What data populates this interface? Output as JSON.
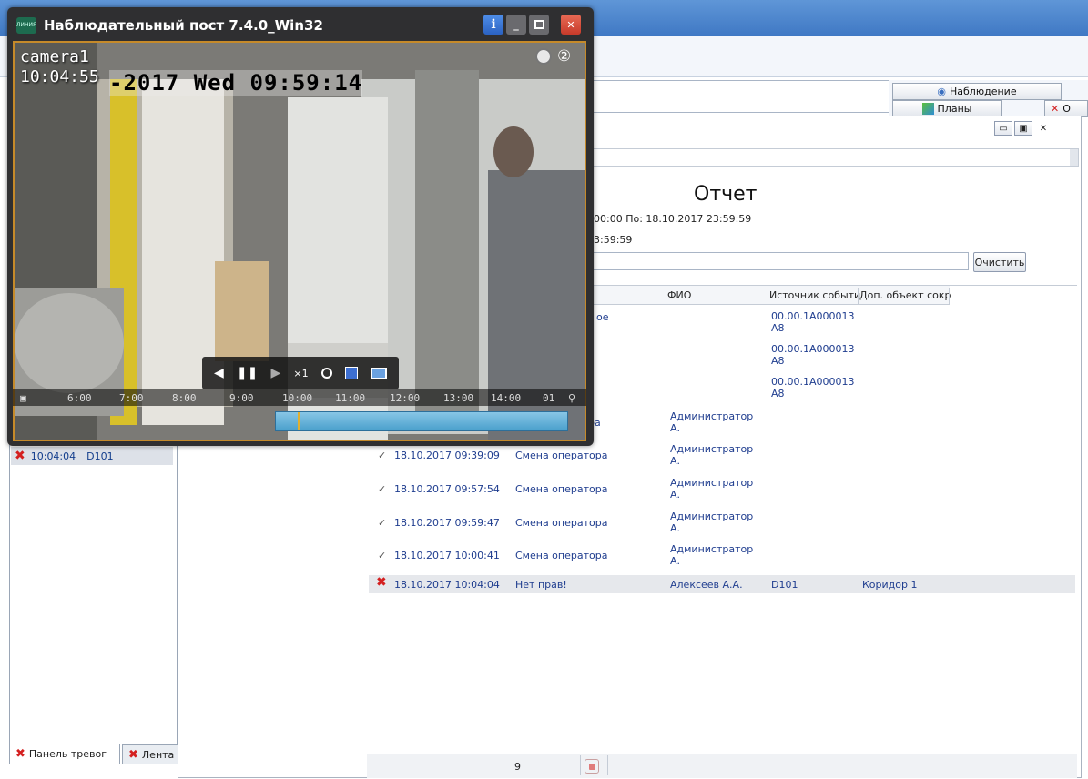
{
  "app": {
    "title": "Наблюдательный пост 7.4.0_Win32",
    "logo_text": "ЛИНИЯ"
  },
  "video": {
    "camera_name": "camera1",
    "time": "10:04:55",
    "osd_text": "-2017 Wed 09:59:14",
    "speed": "×1",
    "badge": "②",
    "timeline_ticks": [
      "6:00",
      "7:00",
      "8:00",
      "9:00",
      "10:00",
      "11:00",
      "12:00",
      "13:00",
      "14:00"
    ],
    "end_label": "01"
  },
  "bg": {
    "tab_observation": "Наблюдение",
    "tab_plans": "Планы",
    "tab_partial": "О",
    "left_alarm_time": "10:04:04",
    "left_alarm_source": "D101",
    "bottom_tab1": "Панель тревог",
    "bottom_tab2": "Лента"
  },
  "report": {
    "title": "Отчет",
    "range_line": "00:00  По: 18.10.2017 23:59:59",
    "range_line2": "3:59:59",
    "clear_button": "Очистить",
    "columns": {
      "fio": "ФИО",
      "source": "Источник событи",
      "extra": "Доп. объект сокр"
    },
    "partial_event_text": "ое",
    "partial_event_text2": "ра",
    "source_rows": [
      {
        "line1": "00.00.1A000013",
        "line2": "A8"
      },
      {
        "line1": "00.00.1A000013",
        "line2": "A8"
      },
      {
        "line1": "00.00.1A000013",
        "line2": "A8"
      }
    ],
    "first_fio": {
      "line1": "Администратор",
      "line2": "А."
    },
    "rows": [
      {
        "datetime": "18.10.2017 09:39:09",
        "event": "Смена оператора",
        "fio1": "Администратор",
        "fio2": "А."
      },
      {
        "datetime": "18.10.2017 09:57:54",
        "event": "Смена оператора",
        "fio1": "Администратор",
        "fio2": "А."
      },
      {
        "datetime": "18.10.2017 09:59:47",
        "event": "Смена оператора",
        "fio1": "Администратор",
        "fio2": "А."
      },
      {
        "datetime": "18.10.2017 10:00:41",
        "event": "Смена оператора",
        "fio1": "Администратор",
        "fio2": "А."
      }
    ],
    "alarm_row": {
      "datetime": "18.10.2017 10:04:04",
      "event": "Нет прав!",
      "fio": "Алексеев А.А.",
      "source": "D101",
      "extra": "Коридор 1"
    },
    "status_count": "9"
  },
  "colors": {
    "link_blue": "#1f3d8f",
    "alarm_red": "#d42020",
    "accent_orange": "#c58a2a"
  }
}
